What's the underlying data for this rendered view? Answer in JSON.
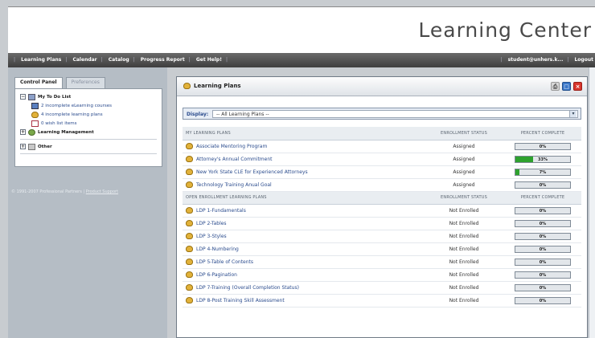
{
  "header": {
    "title": "Learning Center"
  },
  "nav": {
    "left": [
      "Learning Plans",
      "Calendar",
      "Catalog",
      "Progress Report",
      "Get Help!"
    ],
    "right": [
      "student@unhers.k...",
      "Logout"
    ]
  },
  "sidebar": {
    "tabs": [
      {
        "label": "Control Panel",
        "active": true
      },
      {
        "label": "Preferences",
        "active": false
      }
    ],
    "tree": {
      "todo": {
        "label": "My To Do List",
        "items": [
          {
            "label": "2 incomplete eLearning courses",
            "icon": "course-icon"
          },
          {
            "label": "4 incomplete learning plans",
            "icon": "plan-icon"
          },
          {
            "label": "0 wish list items",
            "icon": "wish-list-icon"
          }
        ]
      },
      "learning_management": "Learning Management",
      "other": "Other"
    },
    "footer": {
      "copyright": "© 1991-2007 Professional Partners |",
      "link": "Product Support"
    }
  },
  "window": {
    "title": "Learning Plans",
    "filter": {
      "label": "Display:",
      "value": "-- All Learning Plans --"
    },
    "sections": [
      {
        "headers": [
          "My Learning Plans",
          "Enrollment Status",
          "Percent Complete"
        ],
        "rows": [
          {
            "name": "Associate Mentoring Program",
            "status": "Assigned",
            "pct_label": "0%",
            "pct": 0
          },
          {
            "name": "Attorney's Annual Commitment",
            "status": "Assigned",
            "pct_label": "33%",
            "pct": 33
          },
          {
            "name": "New York State CLE for Experienced Attorneys",
            "status": "Assigned",
            "pct_label": "7%",
            "pct": 7
          },
          {
            "name": "Technology Training Anual Goal",
            "status": "Assigned",
            "pct_label": "0%",
            "pct": 0
          }
        ]
      },
      {
        "headers": [
          "Open Enrollment Learning Plans",
          "Enrollment Status",
          "Percent Complete"
        ],
        "rows": [
          {
            "name": "LDP 1-Fundamentals",
            "status": "Not Enrolled",
            "pct_label": "0%",
            "pct": 0
          },
          {
            "name": "LDP 2-Tables",
            "status": "Not Enrolled",
            "pct_label": "0%",
            "pct": 0
          },
          {
            "name": "LDP 3-Styles",
            "status": "Not Enrolled",
            "pct_label": "0%",
            "pct": 0
          },
          {
            "name": "LDP 4-Numbering",
            "status": "Not Enrolled",
            "pct_label": "0%",
            "pct": 0
          },
          {
            "name": "LDP 5-Table of Contents",
            "status": "Not Enrolled",
            "pct_label": "0%",
            "pct": 0
          },
          {
            "name": "LDP 6-Pagination",
            "status": "Not Enrolled",
            "pct_label": "0%",
            "pct": 0
          },
          {
            "name": "LDP 7-Training (Overall Completion Status)",
            "status": "Not Enrolled",
            "pct_label": "0%",
            "pct": 0
          },
          {
            "name": "LDP 8-Post Training Skill Assessment",
            "status": "Not Enrolled",
            "pct_label": "0%",
            "pct": 0
          }
        ]
      }
    ]
  },
  "colors": {
    "progress_fill": "#2ea22e",
    "link": "#2a4b8d",
    "nav_bg": "#4a4a4a"
  }
}
